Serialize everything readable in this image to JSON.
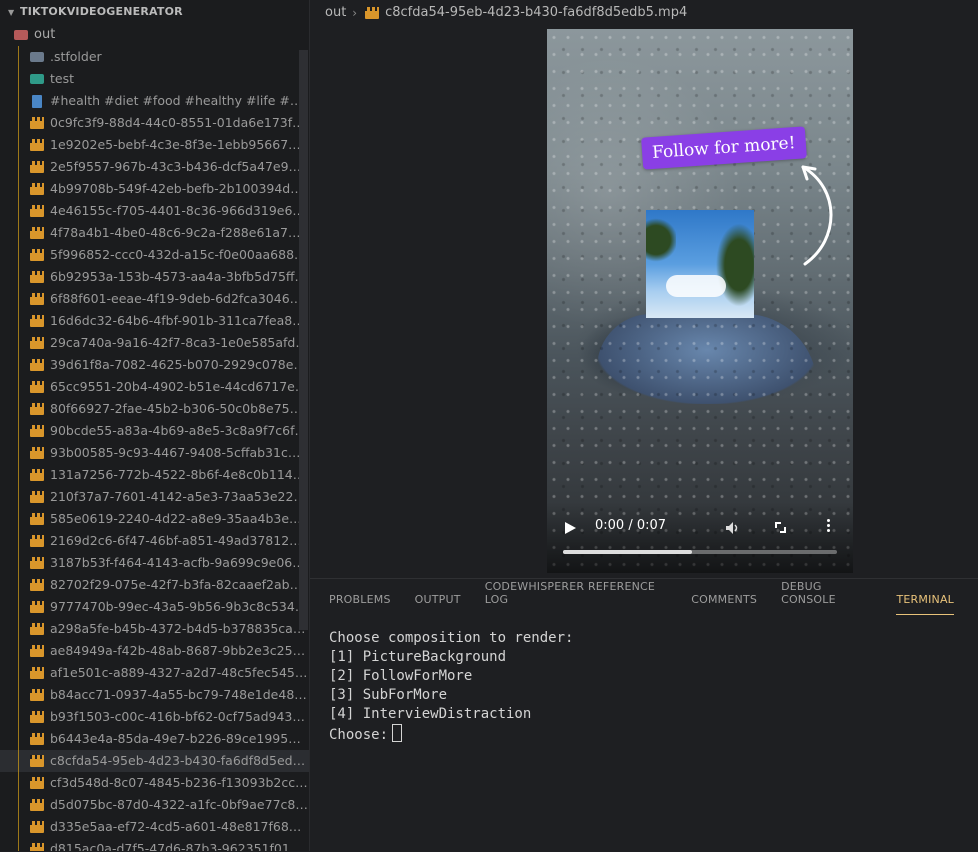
{
  "explorer": {
    "root_label": "TIKTOKVIDEOGENERATOR",
    "out_folder": "out",
    "subfolders": [
      ".stfolder",
      "test"
    ],
    "text_file": "#health #diet #food #healthy #life #pla...",
    "files": [
      "0c9fc3f9-88d4-44c0-8551-01da6e173f9e...",
      "1e9202e5-bebf-4c3e-8f3e-1ebb9566727...",
      "2e5f9557-967b-43c3-b436-dcf5a47e9167...",
      "4b99708b-549f-42eb-befb-2b100394d58...",
      "4e46155c-f705-4401-8c36-966d319e6c1f...",
      "4f78a4b1-4be0-48c6-9c2a-f288e61a7d6a...",
      "5f996852-ccc0-432d-a15c-f0e00aa688d3...",
      "6b92953a-153b-4573-aa4a-3bfb5d75ffe...",
      "6f88f601-eeae-4f19-9deb-6d2fca304699...",
      "16d6dc32-64b6-4fbf-901b-311ca7fea885...",
      "29ca740a-9a16-42f7-8ca3-1e0e585afd2f...",
      "39d61f8a-7082-4625-b070-2929c078e16...",
      "65cc9551-20b4-4902-b51e-44cd6717ef4...",
      "80f66927-2fae-45b2-b306-50c0b8e752c6...",
      "90bcde55-a83a-4b69-a8e5-3c8a9f7c6f7d...",
      "93b00585-9c93-4467-9408-5cffab31c9d8...",
      "131a7256-772b-4522-8b6f-4e8c0b114e2...",
      "210f37a7-7601-4142-a5e3-73aa53e222b...",
      "585e0619-2240-4d22-a8e9-35aa4b3ed9...",
      "2169d2c6-6f47-46bf-a851-49ad378121a...",
      "3187b53f-f464-4143-acfb-9a699c9e06d0...",
      "82702f29-075e-42f7-b3fa-82caaef2abd2...",
      "9777470b-99ec-43a5-9b56-9b3c8c534a9...",
      "a298a5fe-b45b-4372-b4d5-b378835cafc...",
      "ae84949a-f42b-48ab-8687-9bb2e3c2504...",
      "af1e501c-a889-4327-a2d7-48c5fec545fa...",
      "b84acc71-0937-4a55-bc79-748e1de48b4...",
      "b93f1503-c00c-416b-bf62-0cf75ad94315...",
      "b6443e4a-85da-49e7-b226-89ce1995d69...",
      "c8cfda54-95eb-4d23-b430-fa6df8d5edb5...",
      "cf3d548d-8c07-4845-b236-f13093b2cc0a...",
      "d5d075bc-87d0-4322-a1fc-0bf9ae77c8c0...",
      "d335e5aa-ef72-4cd5-a601-48e817f68bf1...",
      "d815ac0a-d7f5-47d6-87b3-962351f014a..."
    ],
    "selected_index": 29
  },
  "editor": {
    "breadcrumb_folder": "out",
    "breadcrumb_file": "c8cfda54-95eb-4d23-b430-fa6df8d5edb5.mp4",
    "video": {
      "overlay_text": "Follow for more!",
      "badge_color": "#8a3fe6",
      "time": "0:00 / 0:07",
      "progress_fraction": 0.47
    }
  },
  "panel": {
    "tabs": [
      "PROBLEMS",
      "OUTPUT",
      "CODEWHISPERER REFERENCE LOG",
      "COMMENTS",
      "DEBUG CONSOLE",
      "TERMINAL"
    ],
    "active_tab": "TERMINAL",
    "terminal_lines": [
      "Choose composition to render:",
      "[1] PictureBackground",
      "[2] FollowForMore",
      "[3] SubForMore",
      "[4] InterviewDistraction"
    ],
    "prompt": "Choose:"
  }
}
